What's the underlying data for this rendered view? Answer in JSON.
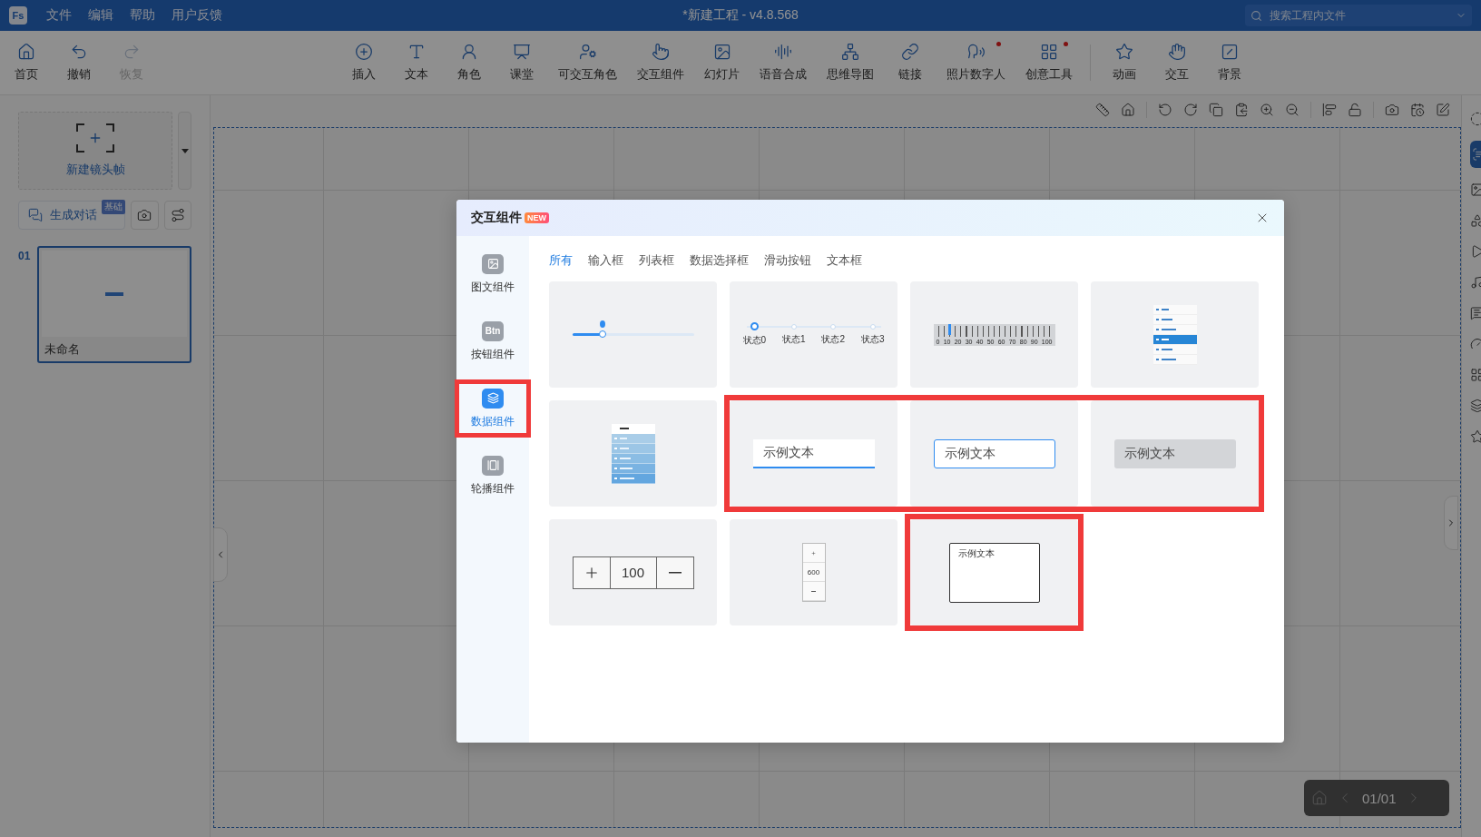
{
  "app": {
    "logo": "Fs",
    "menu": [
      "文件",
      "编辑",
      "帮助",
      "用户反馈"
    ],
    "title": "*新建工程 - v4.8.568",
    "search": {
      "placeholder": "搜索工程内文件"
    }
  },
  "toolbar": {
    "history": [
      {
        "label": "首页",
        "disabled": false,
        "dot": false
      },
      {
        "label": "撤销",
        "disabled": false,
        "dot": false
      },
      {
        "label": "恢复",
        "disabled": true,
        "dot": false
      }
    ],
    "insert": [
      {
        "label": "插入",
        "disabled": false,
        "dot": false
      },
      {
        "label": "文本",
        "disabled": false,
        "dot": false
      },
      {
        "label": "角色",
        "disabled": false,
        "dot": false
      },
      {
        "label": "课堂",
        "disabled": false,
        "dot": false
      },
      {
        "label": "可交互角色",
        "disabled": false,
        "dot": false
      },
      {
        "label": "交互组件",
        "disabled": false,
        "dot": false
      },
      {
        "label": "幻灯片",
        "disabled": false,
        "dot": false
      },
      {
        "label": "语音合成",
        "disabled": false,
        "dot": false
      },
      {
        "label": "思维导图",
        "disabled": false,
        "dot": false
      },
      {
        "label": "链接",
        "disabled": false,
        "dot": false
      },
      {
        "label": "照片数字人",
        "disabled": false,
        "dot": true
      },
      {
        "label": "创意工具",
        "disabled": false,
        "dot": true
      }
    ],
    "effects": [
      {
        "label": "动画",
        "disabled": false,
        "dot": false
      },
      {
        "label": "交互",
        "disabled": false,
        "dot": false
      },
      {
        "label": "背景",
        "disabled": false,
        "dot": false
      }
    ]
  },
  "left_panel": {
    "new_frame": "新建镜头帧",
    "dialog_button": "生成对话",
    "dialog_badge": "基础",
    "slides": [
      {
        "number": "01",
        "name": "未命名",
        "selected": true
      }
    ]
  },
  "page_indicator": "01/01",
  "dialog": {
    "title": "交互组件",
    "badge": "NEW",
    "nav": [
      {
        "label": "图文组件",
        "selected": false,
        "highlighted": false
      },
      {
        "label": "按钮组件",
        "icon_text": "Btn",
        "selected": false,
        "highlighted": false
      },
      {
        "label": "数据组件",
        "selected": true,
        "highlighted": true
      },
      {
        "label": "轮播组件",
        "selected": false,
        "highlighted": false
      }
    ],
    "tabs": [
      {
        "label": "所有",
        "selected": true
      },
      {
        "label": "输入框",
        "selected": false
      },
      {
        "label": "列表框",
        "selected": false
      },
      {
        "label": "数据选择框",
        "selected": false
      },
      {
        "label": "滑动按钮",
        "selected": false
      },
      {
        "label": "文本框",
        "selected": false
      }
    ],
    "cards": [
      {
        "kind": "slider",
        "level": 0.25,
        "highlighted": false
      },
      {
        "kind": "steps",
        "steps": [
          {
            "label": "状态0",
            "selected": true
          },
          {
            "label": "状态1",
            "selected": false
          },
          {
            "label": "状态2",
            "selected": false
          },
          {
            "label": "状态3",
            "selected": false
          }
        ],
        "highlighted": false
      },
      {
        "kind": "ruler",
        "labels": [
          "0",
          "10",
          "20",
          "30",
          "40",
          "50",
          "60",
          "70",
          "80",
          "90",
          "100"
        ],
        "highlighted": false
      },
      {
        "kind": "menu",
        "rows": [
          {
            "selected": false
          },
          {
            "selected": false
          },
          {
            "selected": false
          },
          {
            "selected": true
          },
          {
            "selected": false
          },
          {
            "selected": false
          }
        ],
        "highlighted": false
      },
      {
        "kind": "table",
        "highlighted": false
      },
      {
        "kind": "input-underline",
        "value": "示例文本",
        "highlighted": true
      },
      {
        "kind": "input-outline",
        "value": "示例文本",
        "highlighted": true
      },
      {
        "kind": "input-filled",
        "value": "示例文本",
        "highlighted": true
      },
      {
        "kind": "stepper",
        "value": "100",
        "highlighted": false
      },
      {
        "kind": "vstepper",
        "value": "600",
        "highlighted": false
      },
      {
        "kind": "textarea",
        "value": "示例文本",
        "highlighted": true
      }
    ]
  }
}
